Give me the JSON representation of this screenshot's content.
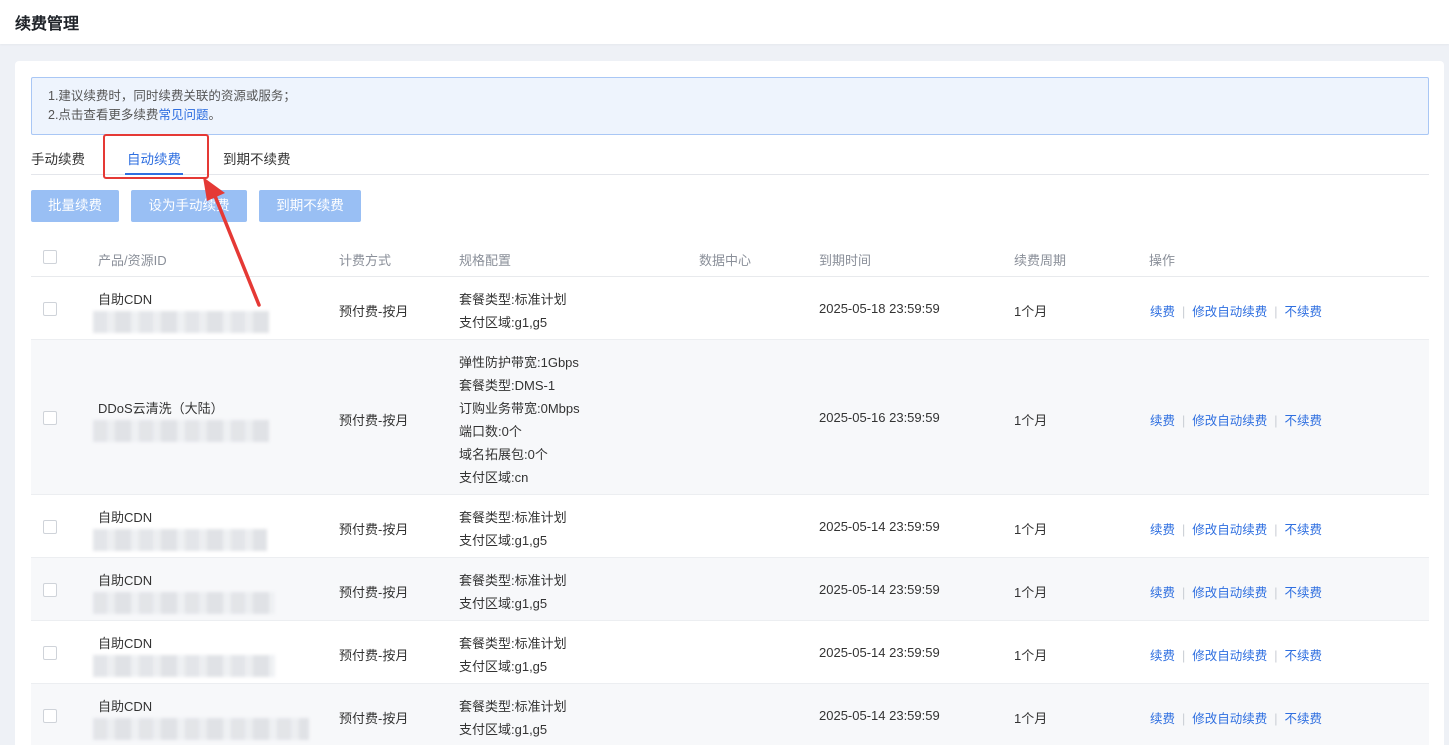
{
  "page": {
    "title": "续费管理"
  },
  "notice": {
    "line1": "1.建议续费时，同时续费关联的资源或服务；",
    "line2_prefix": "2.点击查看更多续费",
    "line2_link": "常见问题",
    "line2_suffix": "。"
  },
  "tabs": [
    {
      "label": "手动续费",
      "active": false
    },
    {
      "label": "自动续费",
      "active": true
    },
    {
      "label": "到期不续费",
      "active": false
    }
  ],
  "actions": {
    "batch_renew": "批量续费",
    "set_manual": "设为手动续费",
    "no_renew": "到期不续费"
  },
  "table": {
    "headers": {
      "product": "产品/资源ID",
      "billing": "计费方式",
      "spec": "规格配置",
      "datacenter": "数据中心",
      "expire": "到期时间",
      "period": "续费周期",
      "ops": "操作"
    },
    "ops_labels": {
      "renew": "续费",
      "modify": "修改自动续费",
      "cancel": "不续费"
    },
    "rows": [
      {
        "product": "自助CDN",
        "billing": "预付费-按月",
        "spec": [
          "套餐类型:标准计划",
          "支付区域:g1,g5"
        ],
        "datacenter": "",
        "expire": "2025-05-18 23:59:59",
        "period": "1个月"
      },
      {
        "product": "DDoS云清洗（大陆）",
        "billing": "预付费-按月",
        "spec": [
          "弹性防护带宽:1Gbps",
          "套餐类型:DMS-1",
          "订购业务带宽:0Mbps",
          "端口数:0个",
          "域名拓展包:0个",
          "支付区域:cn"
        ],
        "datacenter": "",
        "expire": "2025-05-16 23:59:59",
        "period": "1个月"
      },
      {
        "product": "自助CDN",
        "billing": "预付费-按月",
        "spec": [
          "套餐类型:标准计划",
          "支付区域:g1,g5"
        ],
        "datacenter": "",
        "expire": "2025-05-14 23:59:59",
        "period": "1个月"
      },
      {
        "product": "自助CDN",
        "billing": "预付费-按月",
        "spec": [
          "套餐类型:标准计划",
          "支付区域:g1,g5"
        ],
        "datacenter": "",
        "expire": "2025-05-14 23:59:59",
        "period": "1个月"
      },
      {
        "product": "自助CDN",
        "billing": "预付费-按月",
        "spec": [
          "套餐类型:标准计划",
          "支付区域:g1,g5"
        ],
        "datacenter": "",
        "expire": "2025-05-14 23:59:59",
        "period": "1个月"
      },
      {
        "product": "自助CDN",
        "billing": "预付费-按月",
        "spec": [
          "套餐类型:标准计划",
          "支付区域:g1,g5"
        ],
        "datacenter": "",
        "expire": "2025-05-14 23:59:59",
        "period": "1个月"
      }
    ]
  },
  "colors": {
    "accent": "#2f6fe0",
    "button_disabled": "#99bff4",
    "highlight": "#e53935"
  }
}
